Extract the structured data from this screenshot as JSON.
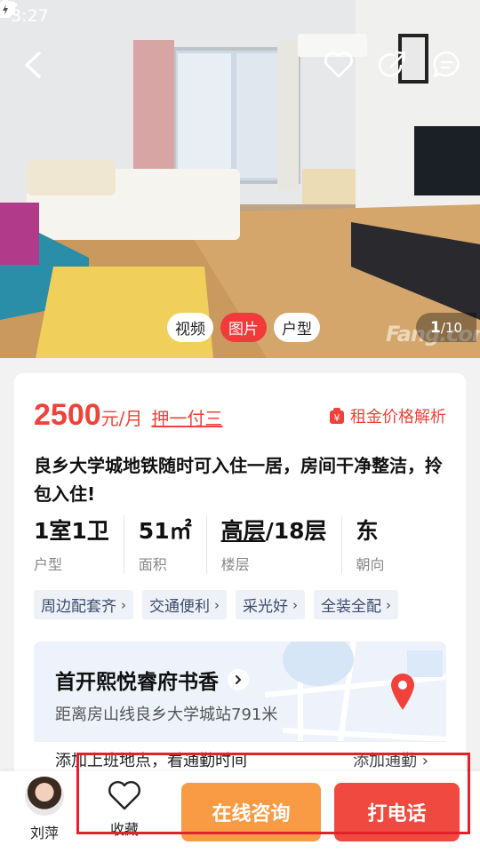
{
  "status_bar": {
    "time": "3:27"
  },
  "photo": {
    "media_tabs": [
      "视频",
      "图片",
      "户型"
    ],
    "active_tab": "图片",
    "counter_current": "1",
    "counter_total": "/10",
    "watermark": "Fang.com"
  },
  "listing": {
    "price": "2500",
    "price_unit": "元/月",
    "payment_term": "押一付三",
    "price_analysis": "租金价格解析",
    "title": "良乡大学城地铁随时可入住一居，房间干净整洁，拎包入住!",
    "attributes": [
      {
        "value": "1室1卫",
        "label": "户型"
      },
      {
        "value": "51㎡",
        "label": "面积"
      },
      {
        "value_underlined": "高层",
        "value_rest": "/18层",
        "label": "楼层"
      },
      {
        "value": "东",
        "label": "朝向"
      }
    ],
    "tags": [
      "周边配套齐",
      "交通便利",
      "采光好",
      "全装全配"
    ]
  },
  "community": {
    "name": "首开熙悦睿府书香",
    "distance": "距离房山线良乡大学城站791米",
    "commute_prompt": "添加上班地点，看通勤时间",
    "commute_action": "添加通勤"
  },
  "bottom_bar": {
    "agent_name": "刘萍",
    "collect_label": "收藏",
    "consult_label": "在线咨询",
    "call_label": "打电话"
  },
  "colors": {
    "accent_red": "#f0423a",
    "consult_orange": "#f99a45",
    "call_red": "#f04a40",
    "highlight_border": "#e3212b"
  }
}
